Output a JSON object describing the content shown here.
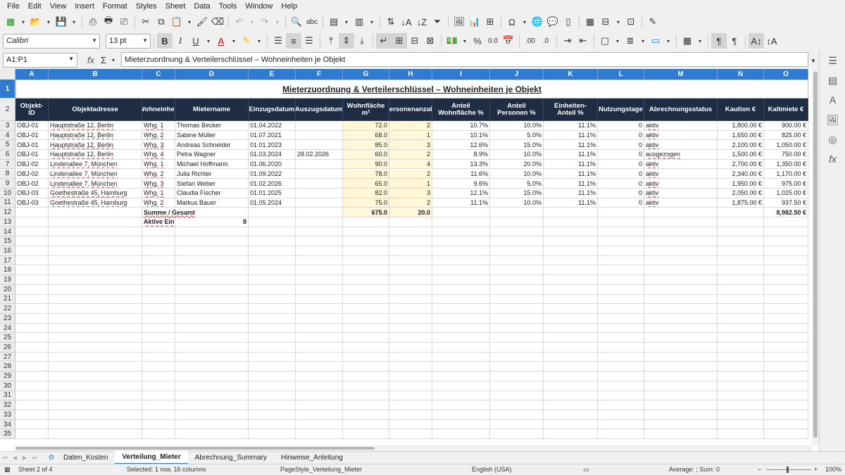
{
  "menu": [
    "File",
    "Edit",
    "View",
    "Insert",
    "Format",
    "Styles",
    "Sheet",
    "Data",
    "Tools",
    "Window",
    "Help"
  ],
  "font": {
    "name": "Calibri",
    "size": "13 pt"
  },
  "namebox": "A1:P1",
  "formula": "Mieterzuordnung & Verteilerschlüssel – Wohneinheiten je Objekt",
  "columns": [
    "A",
    "B",
    "C",
    "D",
    "E",
    "F",
    "G",
    "H",
    "I",
    "J",
    "K",
    "L",
    "M",
    "N",
    "O"
  ],
  "title": "Mieterzuordnung & Verteilerschlüssel – Wohneinheiten je Objekt",
  "headers": [
    "Objekt-ID",
    "Objektadresse",
    "Wohneinheit",
    "Mietername",
    "Einzugsdatum",
    "Auszugsdatum",
    "Wohnfläche m²",
    "Personenanzahl",
    "Anteil Wohnfläche %",
    "Anteil Personen %",
    "Einheiten-Anteil %",
    "Nutzungstage",
    "Abrechnungsstatus",
    "Kaution €",
    "Kaltmiete €"
  ],
  "rows": [
    [
      "OBJ-01",
      "Hauptstraße 12, Berlin",
      "Whg. 1",
      "Thomas Becker",
      "01.04.2022",
      "",
      "72.0",
      "2",
      "10.7%",
      "10.0%",
      "11.1%",
      "0",
      "aktiv",
      "1,800.00 €",
      "900.00 €"
    ],
    [
      "OBJ-01",
      "Hauptstraße 12, Berlin",
      "Whg. 2",
      "Sabine Müller",
      "01.07.2021",
      "",
      "68.0",
      "1",
      "10.1%",
      "5.0%",
      "11.1%",
      "0",
      "aktiv",
      "1,650.00 €",
      "825.00 €"
    ],
    [
      "OBJ-01",
      "Hauptstraße 12, Berlin",
      "Whg. 3",
      "Andreas Schneider",
      "01.01.2023",
      "",
      "85.0",
      "3",
      "12.6%",
      "15.0%",
      "11.1%",
      "0",
      "aktiv",
      "2,100.00 €",
      "1,050.00 €"
    ],
    [
      "OBJ-01",
      "Hauptstraße 12, Berlin",
      "Whg. 4",
      "Petra Wagner",
      "01.03.2024",
      "28.02.2026",
      "60.0",
      "2",
      "8.9%",
      "10.0%",
      "11.1%",
      "0",
      "ausgezogen",
      "1,500.00 €",
      "750.00 €"
    ],
    [
      "OBJ-02",
      "Lindenallee 7, München",
      "Whg. 1",
      "Michael Hoffmann",
      "01.06.2020",
      "",
      "90.0",
      "4",
      "13.3%",
      "20.0%",
      "11.1%",
      "0",
      "aktiv",
      "2,700.00 €",
      "1,350.00 €"
    ],
    [
      "OBJ-02",
      "Lindenallee 7, München",
      "Whg. 2",
      "Julia Richter",
      "01.09.2022",
      "",
      "78.0",
      "2",
      "11.6%",
      "10.0%",
      "11.1%",
      "0",
      "aktiv",
      "2,340.00 €",
      "1,170.00 €"
    ],
    [
      "OBJ-02",
      "Lindenallee 7, München",
      "Whg. 3",
      "Stefan Weber",
      "01.02.2026",
      "",
      "65.0",
      "1",
      "9.6%",
      "5.0%",
      "11.1%",
      "0",
      "aktiv",
      "1,950.00 €",
      "975.00 €"
    ],
    [
      "OBJ-03",
      "Goethestraße 45, Hamburg",
      "Whg. 1",
      "Claudia Fischer",
      "01.01.2025",
      "",
      "82.0",
      "3",
      "12.1%",
      "15.0%",
      "11.1%",
      "0",
      "aktiv",
      "2,050.00 €",
      "1,025.00 €"
    ],
    [
      "OBJ-03",
      "Goethestraße 45, Hamburg",
      "Whg. 2",
      "Markus Bauer",
      "01.05.2024",
      "",
      "75.0",
      "2",
      "11.1%",
      "10.0%",
      "11.1%",
      "0",
      "aktiv",
      "1,875.00 €",
      "937.50 €"
    ]
  ],
  "summary": {
    "label": "Summe / Gesamt",
    "area": "675.0",
    "persons": "20.0",
    "rent": "8,982.50 €",
    "active_label": "Aktive Einh",
    "active_value": "8"
  },
  "rownums": [
    "1",
    "2",
    "3",
    "4",
    "5",
    "6",
    "7",
    "8",
    "9",
    "10",
    "11",
    "12",
    "13",
    "14",
    "15",
    "16",
    "17",
    "18",
    "19",
    "20",
    "21",
    "22",
    "23",
    "24",
    "25",
    "26",
    "27",
    "28",
    "29",
    "30",
    "31",
    "32",
    "33",
    "34",
    "35"
  ],
  "tabs": [
    "Daten_Kosten",
    "Verteilung_Mieter",
    "Abrechnung_Summary",
    "Hinweise_Anleitung"
  ],
  "status": {
    "sheet": "Sheet 2 of 4",
    "selected": "Selected: 1 row, 16 columns",
    "pagestyle": "PageStyle_Verteilung_Mieter",
    "lang": "English (USA)",
    "avg": "Average: ; Sum: 0",
    "zoom": "100%"
  }
}
